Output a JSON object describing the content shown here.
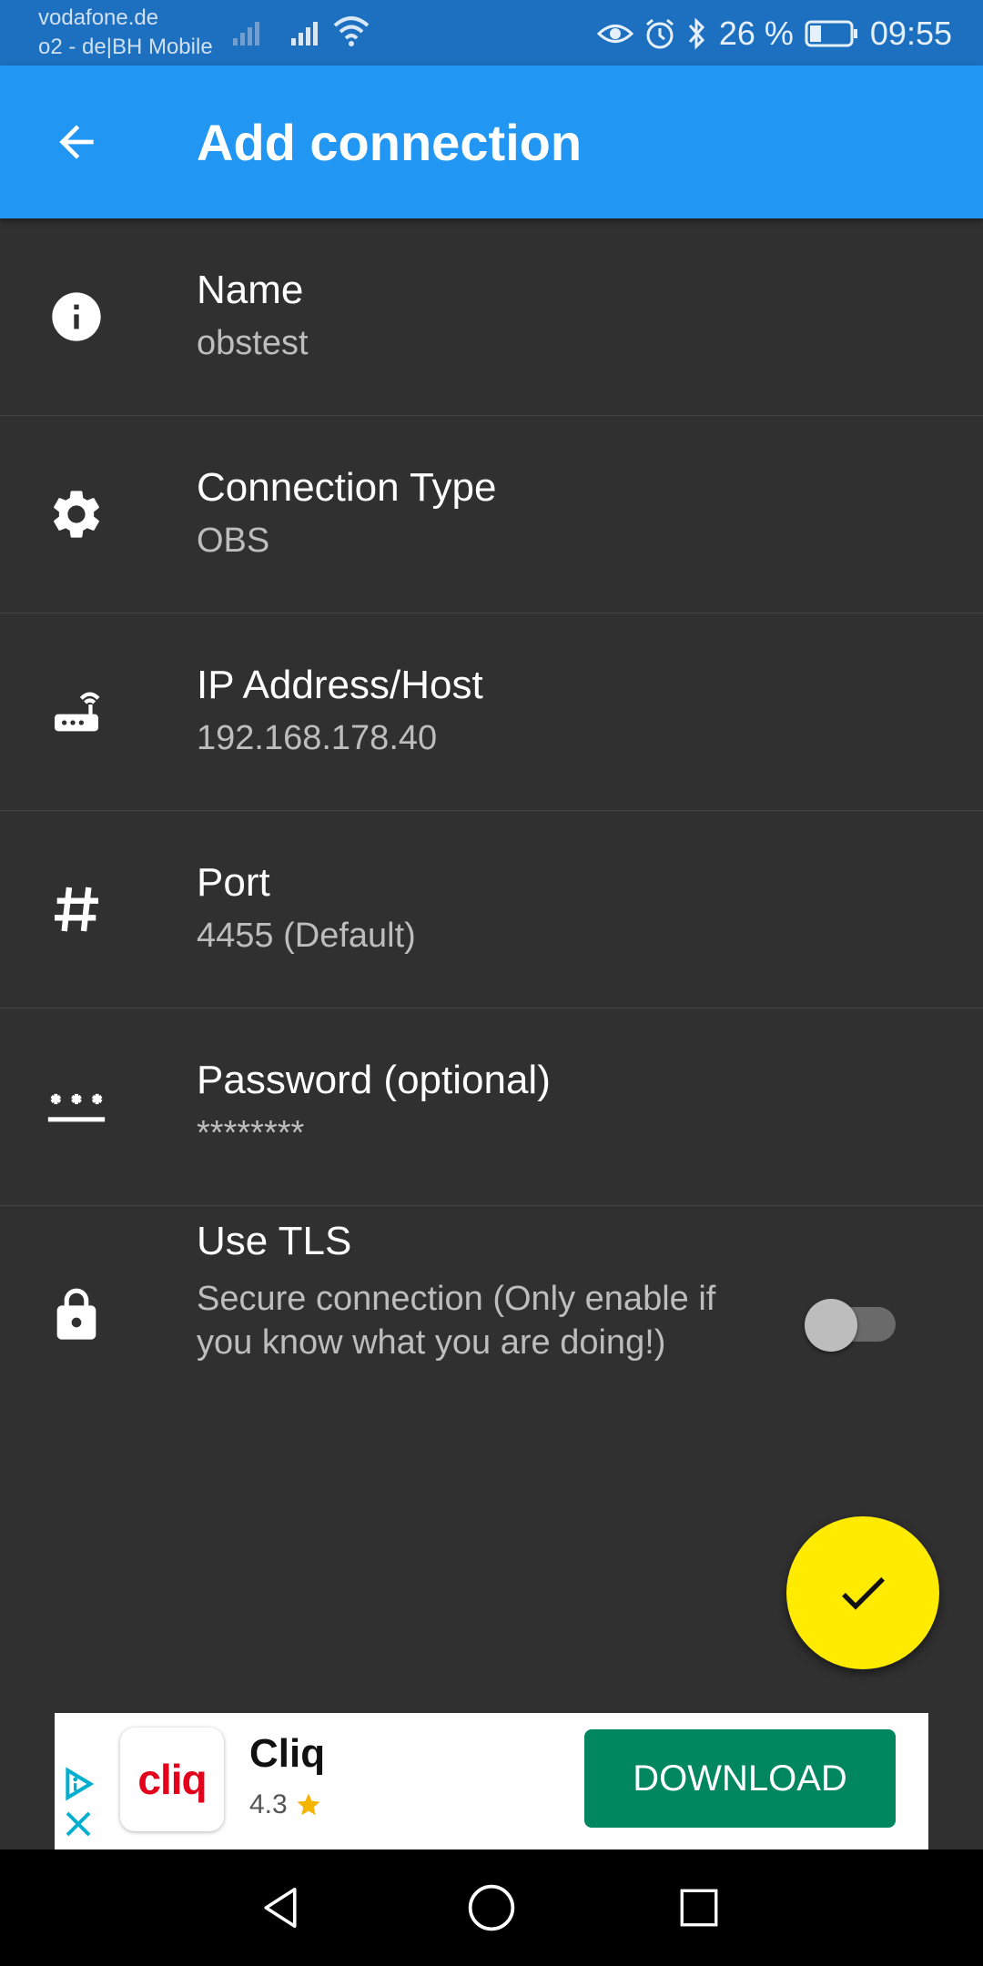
{
  "status_bar": {
    "carrier_1": "vodafone.de",
    "carrier_2": "o2 - de|BH Mobile",
    "battery_percent": "26 %",
    "time": "09:55"
  },
  "app_bar": {
    "title": "Add connection",
    "back_icon": "arrow-back-icon",
    "color": "#2196f3"
  },
  "fields": [
    {
      "icon": "info-icon",
      "title": "Name",
      "value": "obstest"
    },
    {
      "icon": "gear-icon",
      "title": "Connection Type",
      "value": "OBS"
    },
    {
      "icon": "router-icon",
      "title": "IP Address/Host",
      "value": "192.168.178.40"
    },
    {
      "icon": "hash-icon",
      "title": "Port",
      "value": "4455 (Default)"
    },
    {
      "icon": "password-icon",
      "title": "Password (optional)",
      "value": "********"
    },
    {
      "icon": "lock-icon",
      "title": "Use TLS",
      "value": "Secure connection (Only enable if you know what you are doing!)",
      "toggle_on": false
    }
  ],
  "fab": {
    "icon": "check-icon",
    "color": "#ffeb00"
  },
  "ad": {
    "logo_text": "cliq",
    "app_name": "Cliq",
    "rating": "4.3",
    "button_label": "DOWNLOAD",
    "button_color": "#00875f"
  },
  "nav_bar": {
    "back": "nav-back-icon",
    "home": "nav-home-icon",
    "recents": "nav-recents-icon"
  }
}
